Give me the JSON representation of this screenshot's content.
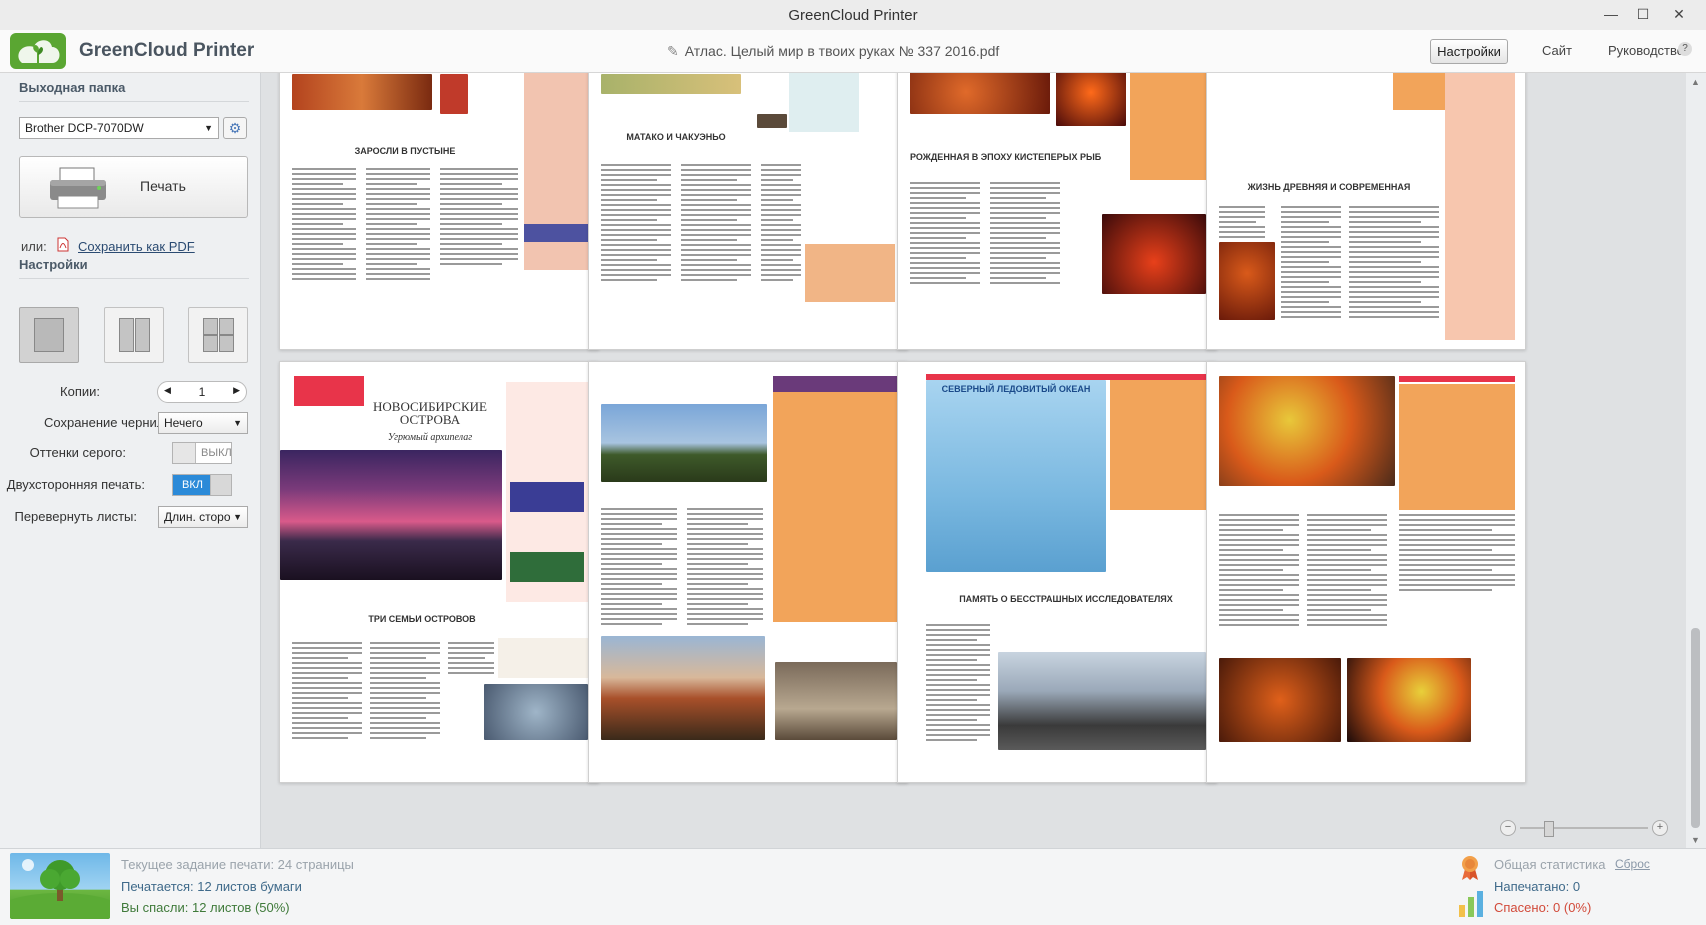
{
  "window": {
    "title": "GreenCloud Printer",
    "minimize": "—",
    "maximize": "☐",
    "close": "✕"
  },
  "header": {
    "brand": "GreenCloud Printer",
    "document": "Атлас. Целый мир в твоих руках № 337 2016.pdf",
    "settings_button": "Настройки",
    "site_link": "Сайт",
    "guide_link": "Руководство",
    "help": "?"
  },
  "sidebar": {
    "output_folder_label": "Выходная папка",
    "printer": "Brother DCP-7070DW",
    "print_button": "Печать",
    "or_label": "или:",
    "save_pdf_link": "Сохранить как PDF",
    "settings_label": "Настройки",
    "copies_label": "Копии:",
    "copies_value": "1",
    "ink_label": "Сохранение чернил:",
    "ink_value": "Нечего",
    "grayscale_label": "Оттенки серого:",
    "grayscale_value": "ВЫКЛ",
    "duplex_label": "Двухсторонняя печать:",
    "duplex_value": "ВКЛ",
    "flip_label": "Перевернуть листы:",
    "flip_value": "Длин. сторо",
    "selected_layout": "1-up"
  },
  "pages": {
    "row1": [
      {
        "left_heading": "ЗАРОСЛИ В ПУСТЫНЕ",
        "right_heading": ""
      },
      {
        "left_heading": "МАТАКО И ЧАКУЭНЬО",
        "right_heading": ""
      },
      {
        "left_heading": "РОЖДЕННАЯ В ЭПОХУ КИСТЕПЕРЫХ РЫБ",
        "right_heading": ""
      },
      {
        "left_heading": "ЖИЗНЬ ДРЕВНЯЯ И СОВРЕМЕННАЯ",
        "right_heading": ""
      }
    ],
    "row2": [
      {
        "title": "НОВОСИБИРСКИЕ ОСТРОВА",
        "subtitle": "Угрюмый архипелаг",
        "heading": "ТРИ СЕМЬИ ОСТРОВОВ"
      },
      {
        "heading": ""
      },
      {
        "map_title": "СЕВЕРНЫЙ ЛЕДОВИТЫЙ ОКЕАН",
        "heading": "ПАМЯТЬ О БЕССТРАШНЫХ ИССЛЕДОВАТЕЛЯХ"
      },
      {
        "heading": ""
      }
    ]
  },
  "zoom": {
    "minus": "−",
    "plus": "+",
    "level": 0.2
  },
  "footer": {
    "current_job": "Текущее задание печати: 24 страницы",
    "printing": "Печатается: 12 листов бумаги",
    "saved": "Вы спасли: 12 листов (50%)",
    "stats_label": "Общая статистика",
    "reset_link": "Сброс",
    "printed": "Напечатано: 0",
    "saved_total": "Спасено: 0 (0%)"
  },
  "colors": {
    "accent": "#2b8ad8",
    "brand_green": "#5aa632",
    "saved_red": "#d24a3a"
  }
}
